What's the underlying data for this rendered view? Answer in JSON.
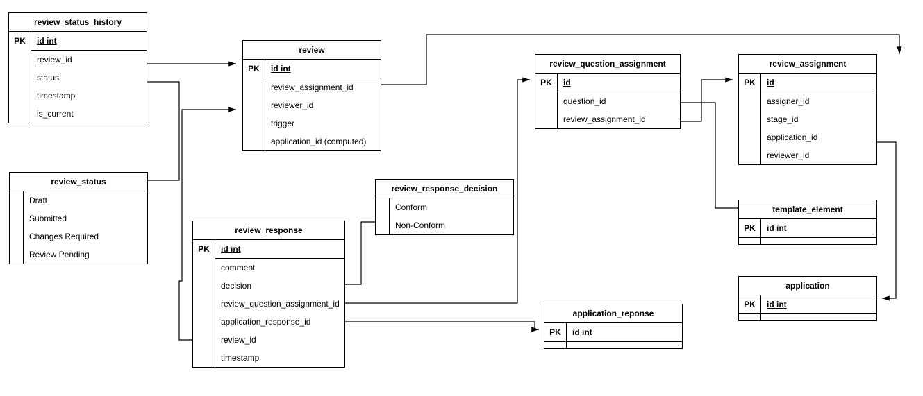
{
  "entities": {
    "review_status_history": {
      "title": "review_status_history",
      "pk_label": "PK",
      "pk_value": "id int",
      "attrs": [
        "review_id",
        "status",
        "timestamp",
        "is_current"
      ]
    },
    "review": {
      "title": "review",
      "pk_label": "PK",
      "pk_value": "id int",
      "attrs": [
        "review_assignment_id",
        "reviewer_id",
        "trigger",
        "application_id (computed)"
      ]
    },
    "review_question_assignment": {
      "title": "review_question_assignment",
      "pk_label": "PK",
      "pk_value": "id",
      "attrs": [
        "question_id",
        "review_assignment_id"
      ]
    },
    "review_assignment": {
      "title": "review_assignment",
      "pk_label": "PK",
      "pk_value": "id",
      "attrs": [
        "assigner_id",
        "stage_id",
        "application_id",
        "reviewer_id"
      ]
    },
    "review_status": {
      "title": "review_status",
      "vals": [
        "Draft",
        "Submitted",
        "Changes Required",
        "Review Pending"
      ]
    },
    "review_response": {
      "title": "review_response",
      "pk_label": "PK",
      "pk_value": "id int",
      "attrs": [
        "comment",
        "decision",
        "review_question_assignment_id",
        "application_response_id",
        "review_id",
        "timestamp"
      ]
    },
    "review_response_decision": {
      "title": "review_response_decision",
      "vals": [
        "Conform",
        "Non-Conform"
      ]
    },
    "application_reponse": {
      "title": "application_reponse",
      "pk_label": "PK",
      "pk_value": "id int",
      "attrs": []
    },
    "template_element": {
      "title": "template_element",
      "pk_label": "PK",
      "pk_value": "id int",
      "attrs": []
    },
    "application": {
      "title": "application",
      "pk_label": "PK",
      "pk_value": "id int",
      "attrs": []
    }
  }
}
